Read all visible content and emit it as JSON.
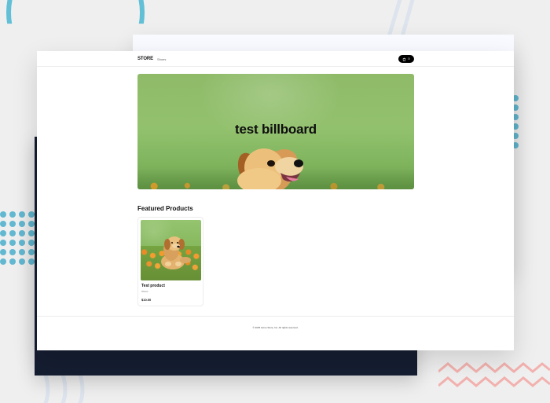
{
  "store": {
    "brand": "STORE",
    "nav_link": "Shoes",
    "cart_count": "0"
  },
  "billboard": {
    "title": "test billboard"
  },
  "section": {
    "featured_title": "Featured Products"
  },
  "product": {
    "name": "Test product",
    "category": "Shoes",
    "price": "$10.00"
  },
  "footer": {
    "text": "© 2025 Acme Store, Inc. All rights reserved."
  },
  "colors": {
    "page_bg": "#efefef",
    "dark_panel": "#151d31",
    "accent_blue": "#62b8d1",
    "accent_pink": "#f3a7a3"
  },
  "icons": {
    "cart": "shopping-bag-icon"
  }
}
